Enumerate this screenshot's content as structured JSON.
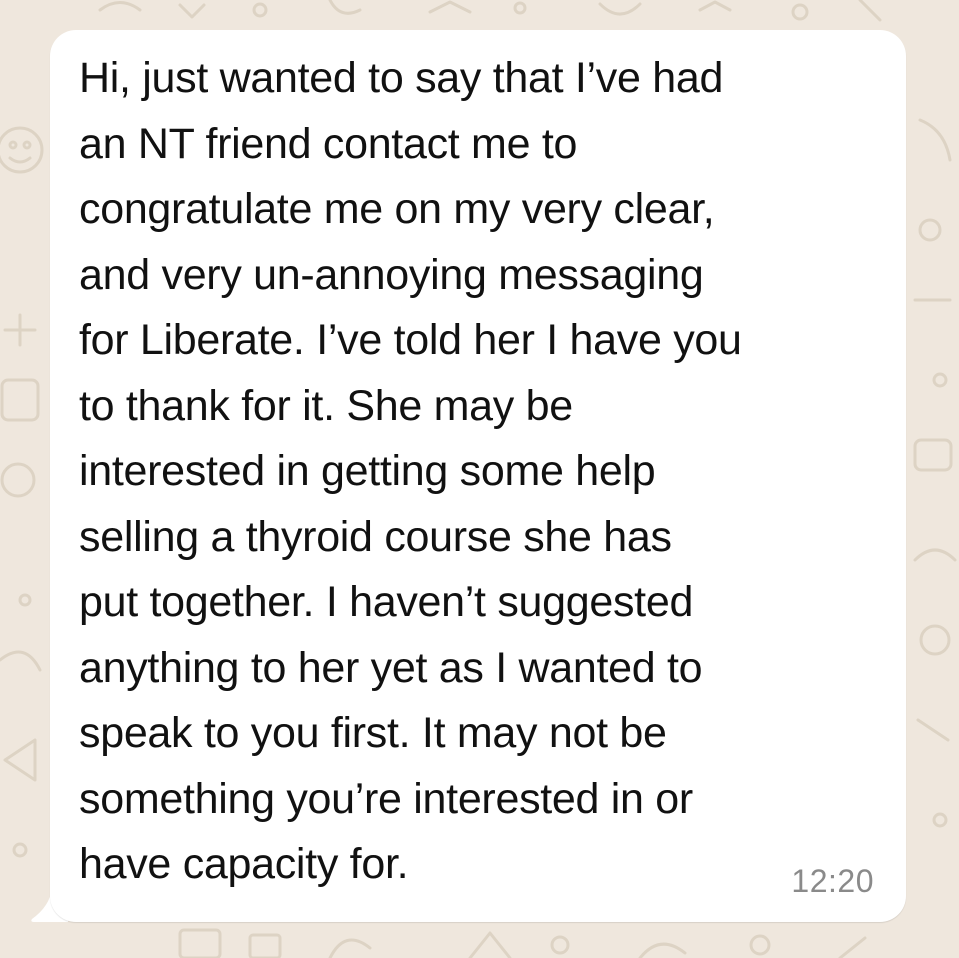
{
  "chat": {
    "background_color": "#efe7dd",
    "doodle_color": "#ddd3c4",
    "bubble_color": "#ffffff"
  },
  "message": {
    "lines": [
      "Hi, just wanted to say that I’ve had",
      "an NT friend contact me to",
      "congratulate me on my very clear,",
      "and very un-annoying messaging",
      "for Liberate. I’ve told her I have you",
      "to thank for it. She may be",
      "interested in getting some help",
      "selling a thyroid course she has",
      "put together. I haven’t suggested",
      "anything to her yet as I wanted to",
      "speak to you first. It may not be",
      "something you’re interested in or",
      "have capacity for."
    ],
    "time": "12:20"
  }
}
